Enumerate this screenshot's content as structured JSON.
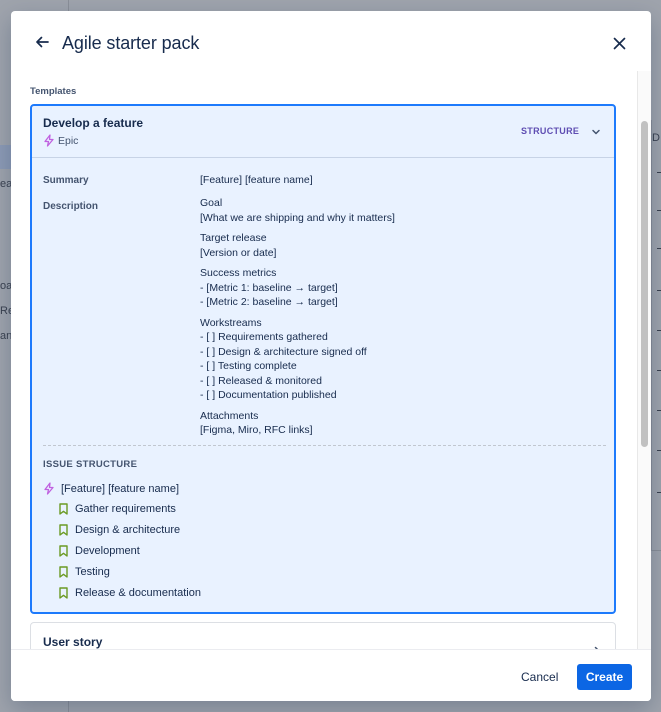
{
  "background": {
    "fragments": [
      "ea",
      "oa",
      "Re",
      "an",
      "D"
    ]
  },
  "modal": {
    "title": "Agile starter pack",
    "back_icon": "arrow-left-icon",
    "close_icon": "close-icon"
  },
  "templates": {
    "section_label": "Templates",
    "selected": {
      "title": "Develop a feature",
      "type": "Epic",
      "type_icon": "lightning-icon",
      "structure_label": "STRUCTURE",
      "summary_label": "Summary",
      "summary_value": "[Feature] [feature name]",
      "description_label": "Description",
      "description": [
        {
          "lines": [
            "Goal",
            "[What we are shipping and why it matters]"
          ]
        },
        {
          "lines": [
            "Target release",
            "[Version or date]"
          ]
        },
        {
          "lines": [
            "Success metrics",
            "- [Metric 1: baseline → target]",
            "- [Metric 2: baseline → target]"
          ]
        },
        {
          "lines": [
            "Workstreams",
            "- [ ] Requirements gathered",
            "- [ ] Design & architecture signed off",
            "- [ ] Testing complete",
            "- [ ] Released & monitored",
            "- [ ] Documentation published"
          ]
        },
        {
          "lines": [
            "Attachments",
            "[Figma, Miro, RFC links]"
          ]
        }
      ],
      "issue_structure_label": "ISSUE STRUCTURE",
      "issue_structure": {
        "parent": "[Feature] [feature name]",
        "children": [
          "Gather requirements",
          "Design & architecture",
          "Development",
          "Testing",
          "Release & documentation"
        ]
      }
    },
    "next": {
      "title": "User story"
    }
  },
  "footer": {
    "cancel_label": "Cancel",
    "create_label": "Create"
  },
  "colors": {
    "accent": "#0c66e4",
    "selected_border": "#1d7afc",
    "selected_bg": "#e9f2ff",
    "epic_icon": "#c061e0",
    "story_icon": "#6a9a23",
    "structure_label": "#5e4db2"
  }
}
